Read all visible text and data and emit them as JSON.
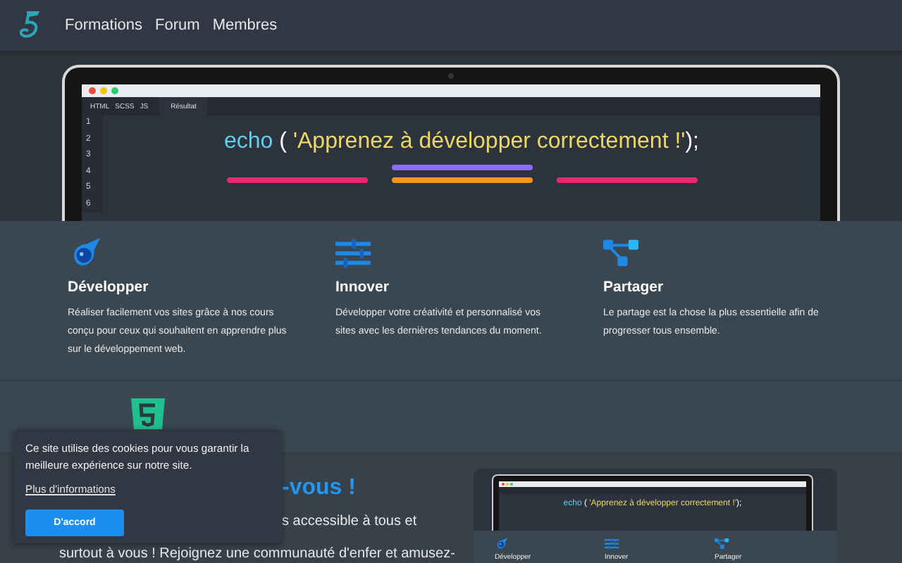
{
  "nav": {
    "items": [
      {
        "label": "Formations"
      },
      {
        "label": "Forum"
      },
      {
        "label": "Membres"
      }
    ]
  },
  "editor": {
    "tabs": [
      {
        "label": "HTML",
        "selected": false
      },
      {
        "label": "SCSS",
        "selected": false
      },
      {
        "label": "JS",
        "selected": false
      },
      {
        "label": "Résultat",
        "selected": true
      }
    ],
    "line_numbers": [
      "1",
      "2",
      "3",
      "4",
      "5",
      "6"
    ],
    "code_keyword": "echo",
    "code_open": "(",
    "code_string": "'Apprenez à développer correctement !'",
    "code_close": ");"
  },
  "features": [
    {
      "kind": "rocket",
      "title": "Développer",
      "text": "Réaliser facilement vos sites grâce à nos cours conçu pour ceux qui souhaitent en apprendre plus sur le développement web."
    },
    {
      "kind": "sliders",
      "title": "Innover",
      "text": "Développer votre créativité et personnalisé vos sites avec les dernières tendances du moment."
    },
    {
      "kind": "share",
      "title": "Partager",
      "text": "Le partage est la chose la plus essentielle afin de progresser tous ensemble."
    }
  ],
  "join": {
    "heading": "-vous !",
    "line_1": "s accessible à tous et",
    "line_2": "surtout à vous ! Rejoignez une communauté d'enfer et amusez-"
  },
  "preview": {
    "code_keyword": "echo",
    "code_open": "(",
    "code_string": "'Apprenez à développer correctement !'",
    "code_close": ");",
    "features": [
      "Développer",
      "Innover",
      "Partager"
    ]
  },
  "cookie_banner": {
    "message": "Ce site utilise des cookies pour vous garantir la meilleure expérience sur notre site.",
    "link": "Plus d'informations",
    "button": "D'accord"
  }
}
